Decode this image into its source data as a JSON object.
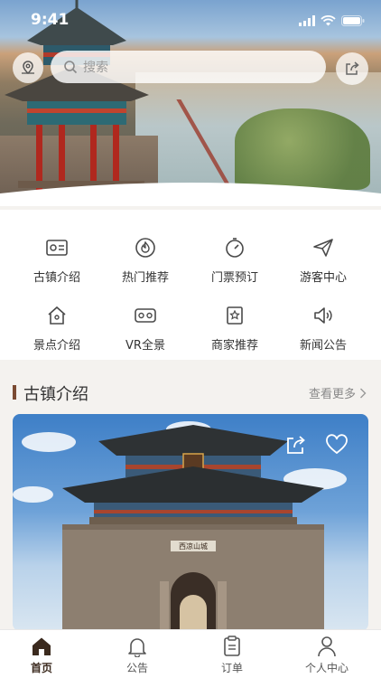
{
  "status_bar": {
    "time": "9:41"
  },
  "search": {
    "placeholder": "搜索"
  },
  "banner": {
    "active_index": 0,
    "dot_count": 3
  },
  "grid": {
    "items": [
      {
        "label": "古镇介绍",
        "icon": "id-card-icon"
      },
      {
        "label": "热门推荐",
        "icon": "flame-icon"
      },
      {
        "label": "门票预订",
        "icon": "timer-icon"
      },
      {
        "label": "游客中心",
        "icon": "paper-plane-icon"
      },
      {
        "label": "景点介绍",
        "icon": "house-icon"
      },
      {
        "label": "VR全景",
        "icon": "vr-headset-icon"
      },
      {
        "label": "商家推荐",
        "icon": "star-bookmark-icon"
      },
      {
        "label": "新闻公告",
        "icon": "speaker-icon"
      }
    ]
  },
  "section": {
    "title": "古镇介绍",
    "more": "查看更多"
  },
  "card": {
    "plaque_text": "西凉山城"
  },
  "tabbar": {
    "tabs": [
      {
        "label": "首页",
        "icon": "home-icon",
        "active": true
      },
      {
        "label": "公告",
        "icon": "bell-icon",
        "active": false
      },
      {
        "label": "订单",
        "icon": "clipboard-icon",
        "active": false
      },
      {
        "label": "个人中心",
        "icon": "person-icon",
        "active": false
      }
    ]
  },
  "colors": {
    "accent": "#7a4a32",
    "active_tab": "#3b2a1e",
    "grid_icon": "#4a4a4a"
  }
}
